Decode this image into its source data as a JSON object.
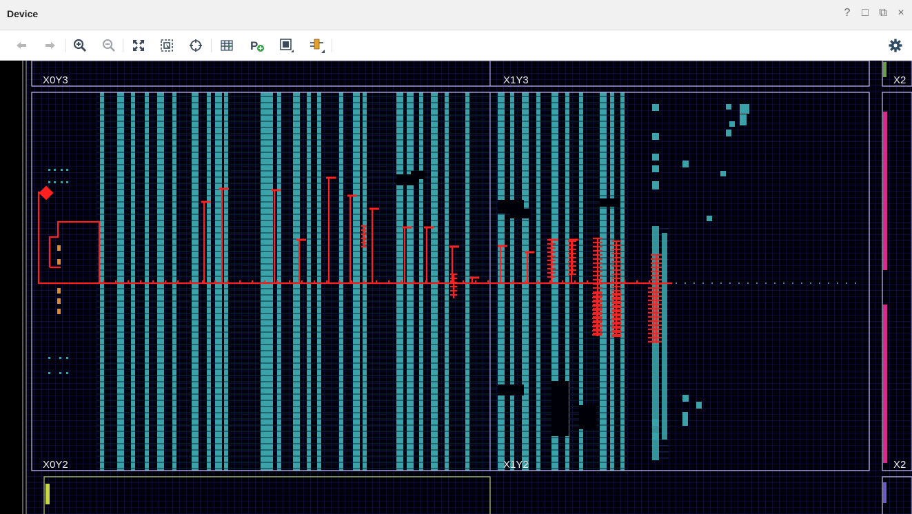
{
  "window": {
    "title": "Device"
  },
  "window_controls": [
    "?",
    "□",
    "⧉",
    "×"
  ],
  "toolbar": {
    "buttons": [
      {
        "icon": "back-arrow-icon"
      },
      {
        "icon": "forward-arrow-icon"
      },
      {
        "icon": "zoom-in-icon"
      },
      {
        "icon": "zoom-out-icon"
      },
      {
        "icon": "zoom-fit-icon"
      },
      {
        "icon": "zoom-to-selected-icon"
      },
      {
        "icon": "auto-fit-selection-icon"
      },
      {
        "icon": "routing-resources-icon"
      },
      {
        "icon": "create-pblock-icon"
      },
      {
        "icon": "draw-rectangle-icon"
      },
      {
        "icon": "place-io-ports-icon"
      }
    ],
    "settings_icon": "gear-icon"
  },
  "colors": {
    "background": "#000008",
    "grid": "#151568",
    "clock_region_border": "#c7bff0",
    "highlight_net": "#ff2020",
    "site_fill": "#3aa2a8"
  },
  "clock_regions": {
    "labels": [
      "X0Y3",
      "X1Y3",
      "X2",
      "X0Y2",
      "X1Y2",
      "X2"
    ]
  }
}
